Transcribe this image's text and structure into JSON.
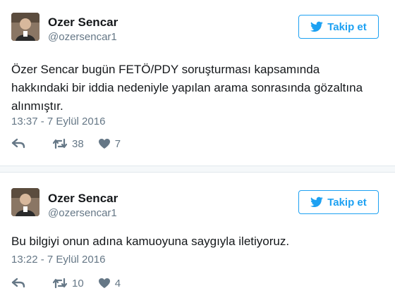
{
  "tweets": [
    {
      "name": "Ozer Sencar",
      "handle": "@ozersencar1",
      "follow_label": "Takip et",
      "text": "Özer Sencar bugün FETÖ/PDY soruşturması kapsamında hakkındaki bir iddia nedeniyle yapılan arama sonrasında gözaltına alınmıştır.",
      "timestamp": "13:37 - 7 Eylül 2016",
      "retweets": "38",
      "likes": "7"
    },
    {
      "name": "Ozer Sencar",
      "handle": "@ozersencar1",
      "follow_label": "Takip et",
      "text": "Bu bilgiyi onun adına kamuoyuna saygıyla iletiyoruz.",
      "timestamp": "13:22 - 7 Eylül 2016",
      "retweets": "10",
      "likes": "4"
    }
  ],
  "icons": {
    "follow": "twitter-bird-icon",
    "reply": "reply-icon",
    "retweet": "retweet-icon",
    "like": "heart-icon"
  },
  "colors": {
    "accent": "#1da1f2",
    "muted": "#657786",
    "text": "#14171a",
    "separator": "#f5f8fa"
  }
}
